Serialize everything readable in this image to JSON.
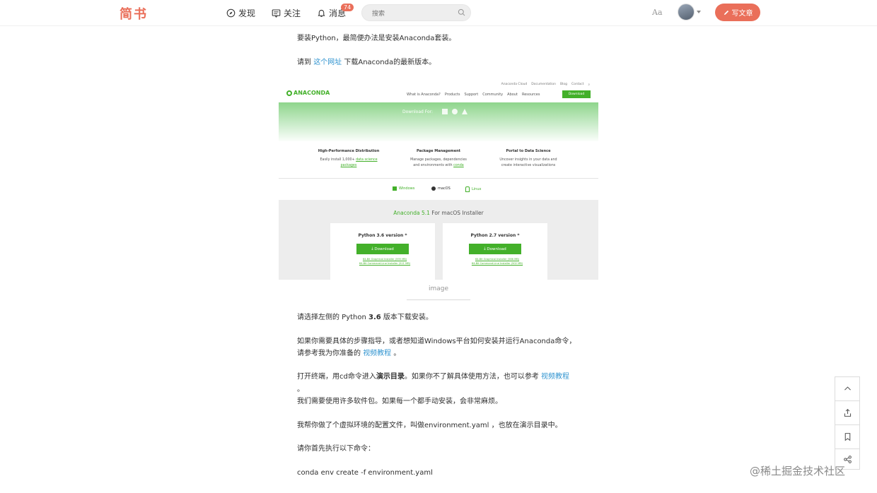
{
  "header": {
    "logo": "简书",
    "nav": [
      {
        "label": "发现",
        "icon": "compass-icon"
      },
      {
        "label": "关注",
        "icon": "follow-icon"
      },
      {
        "label": "消息",
        "icon": "bell-icon",
        "badge": "74"
      }
    ],
    "search_placeholder": "搜索",
    "font_toggle": "Aa",
    "write_label": "写文章",
    "accent": "#ea6f5a"
  },
  "article": {
    "p1": "要装Python，最简便办法是安装Anaconda套装。",
    "p2_pre": "请到 ",
    "p2_link": "这个网址",
    "p2_post": " 下载Anaconda的最新版本。",
    "caption": "image",
    "p3_pre": "请选择左侧的 Python ",
    "p3_bold": "3.6",
    "p3_post": " 版本下载安装。",
    "p4_line1": "如果你需要具体的步骤指导，或者想知道Windows平台如何安装并运行Anaconda命令，",
    "p4_pre": "请参考我为你准备的 ",
    "p4_link": "视频教程",
    "p4_post": " 。",
    "p5_pre": "打开终端，用cd命令进入",
    "p5_bold": "演示目录",
    "p5_mid": "。如果你不了解具体使用方法，也可以参考 ",
    "p5_link": "视频教程",
    "p5_dot": "。",
    "p6": "我们需要使用许多软件包。如果每一个都手动安装，会非常麻烦。",
    "p7": "我帮你做了个虚拟环境的配置文件，叫做environment.yaml ，也放在演示目录中。",
    "p8": "请你首先执行以下命令：",
    "p9": "conda env create -f environment.yaml",
    "link_color": "#3194d0"
  },
  "screenshot": {
    "top_links": [
      "Anaconda Cloud",
      "Documentation",
      "Blog",
      "Contact"
    ],
    "logo": "ANACONDA",
    "menu": [
      "What is Anaconda?",
      "Products",
      "Support",
      "Community",
      "About",
      "Resources"
    ],
    "download_btn": "Download",
    "download_for": "Download For:",
    "features": [
      {
        "title": "High-Performance Distribution",
        "line1_pre": "Easily install 1,000+ ",
        "line1_link": "data science",
        "line2_link": "packages",
        "line2": ""
      },
      {
        "title": "Package Management",
        "line1_pre": "Manage packages, dependencies",
        "line1_link": "",
        "line2": "and environments with ",
        "line2_link": "conda"
      },
      {
        "title": "Portal to Data Science",
        "line1_pre": "Uncover insights in your data and",
        "line1_link": "",
        "line2": "create interactive visualizations",
        "line2_link": ""
      }
    ],
    "os_tabs": [
      "Windows",
      "macOS",
      "Linux"
    ],
    "installer_version": "Anaconda 5.1",
    "installer_title": " For macOS Installer",
    "cards": [
      {
        "title": "Python 3.6 version *",
        "button": "Download",
        "link1": "64-Bit Graphical Installer (595 MB)",
        "link2": "64-Bit Command-Line Installer (511 MB)"
      },
      {
        "title": "Python 2.7 version *",
        "button": "Download",
        "link1": "64-Bit Graphical Installer (586 MB)",
        "link2": "64-Bit Command-Line Installer (502 MB)"
      }
    ],
    "green": "#43b02a"
  },
  "side_tools": [
    "up-arrow-icon",
    "share-upload-icon",
    "bookmark-icon",
    "share-icon"
  ],
  "watermark": "@稀土掘金技术社区"
}
